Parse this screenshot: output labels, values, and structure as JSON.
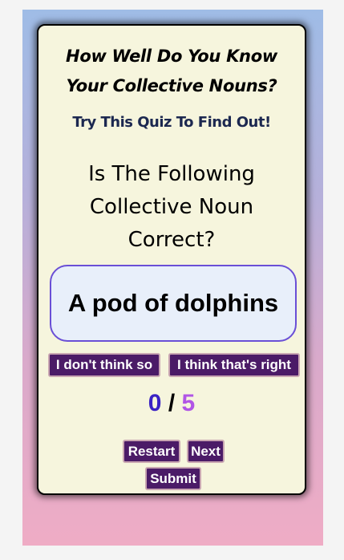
{
  "quiz": {
    "title_line1": "How Well Do You Know",
    "title_line2": "Your Collective Nouns?",
    "subtitle": "Try This Quiz To Find Out!",
    "question_line1": "Is The Following",
    "question_line2": "Collective Noun",
    "question_line3": "Correct?",
    "phrase": "A pod of dolphins"
  },
  "answers": {
    "no_label": "I don't think so",
    "yes_label": "I think that's right"
  },
  "score": {
    "current": "0",
    "separator": "/",
    "total": "5"
  },
  "controls": {
    "restart_label": "Restart",
    "next_label": "Next",
    "submit_label": "Submit"
  },
  "colors": {
    "card_bg": "#f6f5dd",
    "button_bg": "#4b1b67",
    "phrase_border": "#6a4fd6",
    "score_current": "#3a22c4",
    "score_total": "#b155e6"
  }
}
